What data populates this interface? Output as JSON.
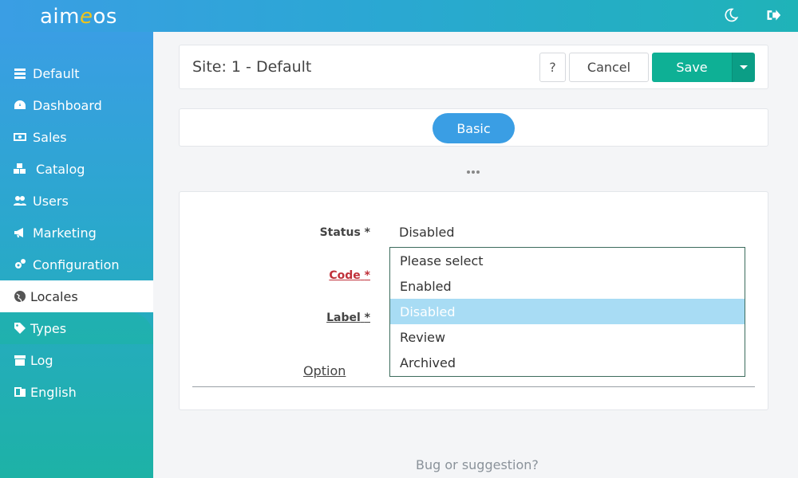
{
  "app": {
    "logo_pre": "aim",
    "logo_e": "e",
    "logo_post": "os"
  },
  "sidebar": {
    "items": [
      {
        "label": "Default",
        "icon": "list-icon"
      },
      {
        "label": "Dashboard",
        "icon": "dashboard-icon"
      },
      {
        "label": "Sales",
        "icon": "money-icon"
      },
      {
        "label": "Catalog",
        "icon": "cubes-icon"
      },
      {
        "label": "Users",
        "icon": "users-icon"
      },
      {
        "label": "Marketing",
        "icon": "megaphone-icon"
      },
      {
        "label": "Configuration",
        "icon": "gears-icon"
      },
      {
        "label": "Locales",
        "icon": "globe-icon"
      },
      {
        "label": "Types",
        "icon": "tag-icon"
      },
      {
        "label": "Log",
        "icon": "archive-icon"
      },
      {
        "label": "English",
        "icon": "language-icon"
      }
    ]
  },
  "header": {
    "title": "Site: 1 - Default",
    "help_label": "?",
    "cancel_label": "Cancel",
    "save_label": "Save"
  },
  "tabs": {
    "basic_label": "Basic"
  },
  "form": {
    "status_label": "Status",
    "status_value": "Disabled",
    "code_label": "Code",
    "label_label": "Label",
    "required_mark": "*",
    "option_label": "Option",
    "status_options": [
      "Please select",
      "Enabled",
      "Disabled",
      "Review",
      "Archived"
    ],
    "selected_option": "Disabled"
  },
  "footer": {
    "bug_label": "Bug or suggestion?"
  },
  "colors": {
    "accent_blue": "#3a9ee4",
    "accent_teal": "#1db2a6",
    "save_green": "#0eb095",
    "required_red": "#c0313a",
    "selected_option_bg": "#a8dcf4"
  }
}
